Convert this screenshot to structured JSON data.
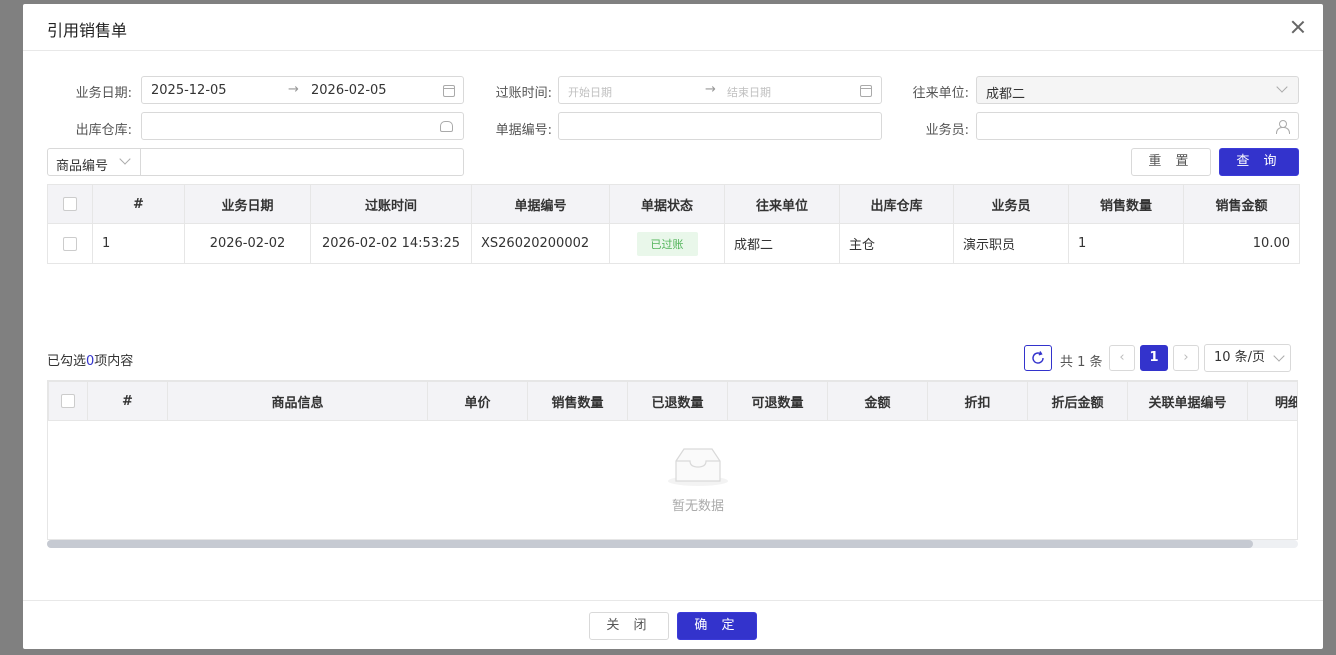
{
  "dialog": {
    "title": "引用销售单"
  },
  "filters": {
    "biz_date_label": "业务日期:",
    "biz_date_start": "2025-12-05",
    "biz_date_end": "2026-02-05",
    "post_time_label": "过账时间:",
    "post_start_placeholder": "开始日期",
    "post_end_placeholder": "结束日期",
    "partner_label": "往来单位:",
    "partner_value": "成都二",
    "warehouse_label": "出库仓库:",
    "doc_no_label": "单据编号:",
    "salesperson_label": "业务员:",
    "product_code_select": "商品编号",
    "reset": "重 置",
    "query": "查 询"
  },
  "orders_table": {
    "headers": [
      "#",
      "业务日期",
      "过账时间",
      "单据编号",
      "单据状态",
      "往来单位",
      "出库仓库",
      "业务员",
      "销售数量",
      "销售金额"
    ],
    "rows": [
      {
        "no": "1",
        "date": "2026-02-02",
        "post_time": "2026-02-02 14:53:25",
        "doc_no": "XS26020200002",
        "status": "已过账",
        "partner": "成都二",
        "warehouse": "主仓",
        "salesperson": "演示职员",
        "qty": "1",
        "amount": "10.00"
      }
    ]
  },
  "selection": {
    "prefix": "已勾选",
    "count": "0",
    "suffix": "项内容"
  },
  "pagination": {
    "total": "共 1 条",
    "current_page": "1",
    "page_size": "10 条/页"
  },
  "detail_table": {
    "headers": [
      "#",
      "商品信息",
      "单价",
      "销售数量",
      "已退数量",
      "可退数量",
      "金额",
      "折扣",
      "折后金额",
      "关联单据编号",
      "明细备注"
    ],
    "empty_text": "暂无数据"
  },
  "footer": {
    "close": "关 闭",
    "confirm": "确 定"
  },
  "colors": {
    "primary": "#3333cc",
    "posted_tag": "#52b45a"
  }
}
